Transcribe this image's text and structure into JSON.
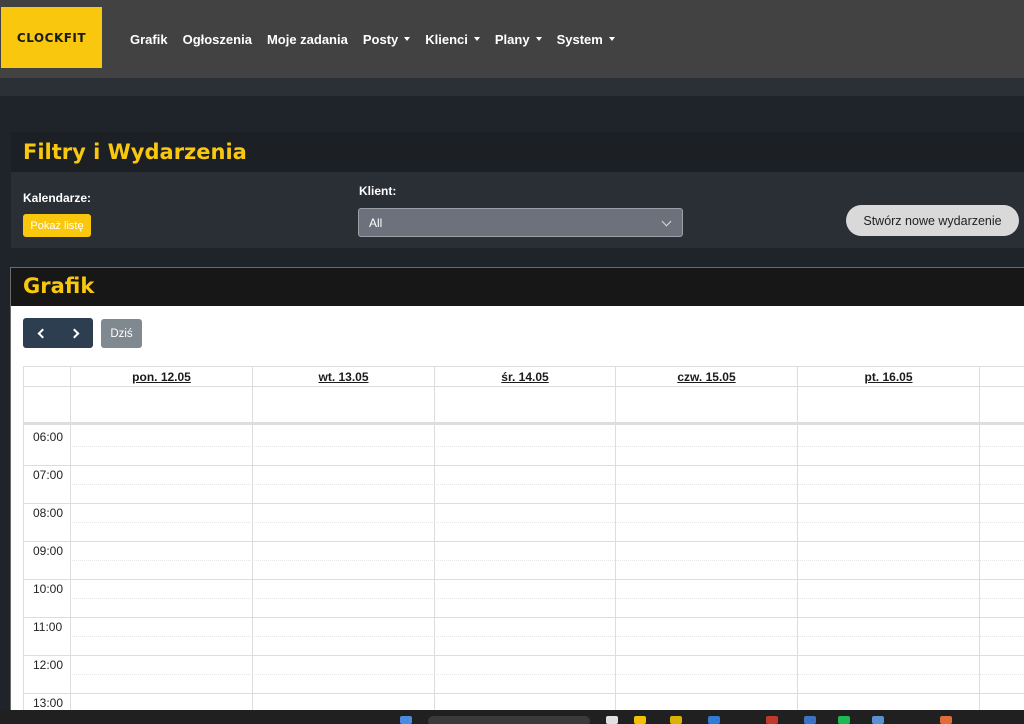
{
  "nav": {
    "logo": "CLOCKFIT",
    "items": [
      {
        "label": "Grafik",
        "dropdown": false
      },
      {
        "label": "Ogłoszenia",
        "dropdown": false
      },
      {
        "label": "Moje zadania",
        "dropdown": false
      },
      {
        "label": "Posty",
        "dropdown": true
      },
      {
        "label": "Klienci",
        "dropdown": true
      },
      {
        "label": "Plany",
        "dropdown": true
      },
      {
        "label": "System",
        "dropdown": true
      }
    ]
  },
  "filters": {
    "title": "Filtry i Wydarzenia",
    "calendars_label": "Kalendarze:",
    "show_list_button": "Pokaż listę",
    "client_label": "Klient:",
    "client_value": "All",
    "create_button": "Stwórz nowe wydarzenie"
  },
  "schedule": {
    "title": "Grafik",
    "today_button": "Dziś",
    "days": [
      "pon. 12.05",
      "wt. 13.05",
      "śr. 14.05",
      "czw. 15.05",
      "pt. 16.05"
    ],
    "hours": [
      "06:00",
      "07:00",
      "08:00",
      "09:00",
      "10:00",
      "11:00",
      "12:00",
      "13:00"
    ]
  },
  "colors": {
    "accent": "#f9c80e",
    "navbar": "#424242",
    "nav_button": "#2c3e50"
  }
}
